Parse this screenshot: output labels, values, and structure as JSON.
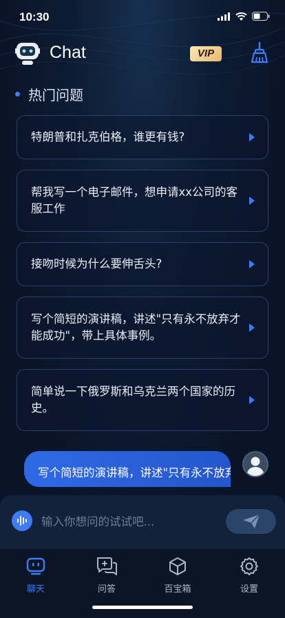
{
  "status_bar": {
    "time": "10:30"
  },
  "header": {
    "title": "Chat",
    "vip_label": "VIP"
  },
  "section": {
    "title": "热门问题"
  },
  "questions": [
    {
      "text": "特朗普和扎克伯格，谁更有钱?"
    },
    {
      "text": "帮我写一个电子邮件，想申请xx公司的客服工作"
    },
    {
      "text": "接吻时候为什么要伸舌头?"
    },
    {
      "text": "写个简短的演讲稿，讲述\"只有永不放弃才能成功\"，带上具体事例。"
    },
    {
      "text": "简单说一下俄罗斯和乌克兰两个国家的历史。"
    }
  ],
  "message": {
    "text": "写个简短的演讲稿，讲述\"只有永不放弃才能成功\"，带上具体事例。"
  },
  "input": {
    "placeholder": "输入你想问的试试吧..."
  },
  "tabs": [
    {
      "label": "聊天",
      "icon": "chat-robot-icon",
      "active": true
    },
    {
      "label": "问答",
      "icon": "qa-icon",
      "active": false
    },
    {
      "label": "百宝箱",
      "icon": "box-icon",
      "active": false
    },
    {
      "label": "设置",
      "icon": "gear-icon",
      "active": false
    }
  ],
  "colors": {
    "accent": "#3d7cf5",
    "vip_gold": "#e9b86c",
    "background": "#0a1428"
  }
}
